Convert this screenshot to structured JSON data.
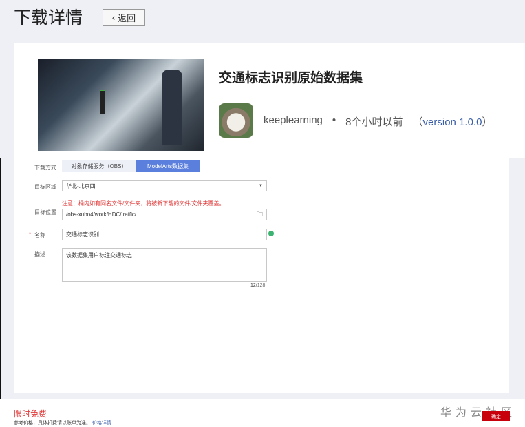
{
  "header": {
    "title": "下载详情",
    "back_label": "返回"
  },
  "dataset": {
    "title": "交通标志识别原始数据集",
    "author": "keeplearning",
    "separator": "•",
    "time": "8个小时以前",
    "version_open": "（",
    "version": "version 1.0.0",
    "version_close": "）"
  },
  "form": {
    "method_label": "下载方式",
    "method_options": [
      "对象存储服务（OBS）",
      "ModelArts数据集"
    ],
    "region_label": "目标区域",
    "region_value": "华北-北京四",
    "warning": "注意：桶内如有同名文件/文件夹，将被新下载的文件/文件夹覆盖。",
    "location_label": "目标位置",
    "location_value": "/obs-xubo4/work/HDC/traffic/",
    "required_mark": "*",
    "name_label": "名称",
    "name_value": "交通标志识别",
    "desc_label": "描述",
    "desc_value": "该数据集用户标注交通标志",
    "char_count": "12",
    "char_max": "/128"
  },
  "footer": {
    "price": "限时免费",
    "note": "参考价格，具体扣费请以账单为准。",
    "price_link": "价格详情",
    "confirm": "确定",
    "watermark": "华为云社区"
  },
  "colors": {
    "accent": "#5b7fdc",
    "danger": "#e03a3a",
    "confirm": "#c7000b"
  }
}
